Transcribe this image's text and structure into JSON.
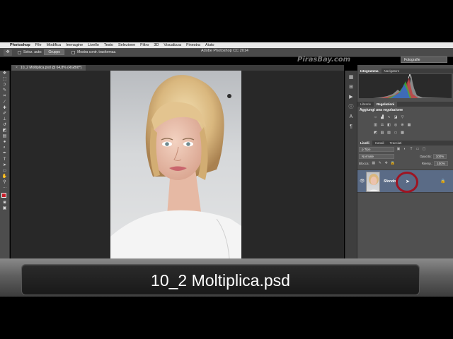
{
  "menubar": {
    "app": "Photoshop",
    "items": [
      "File",
      "Modifica",
      "Immagine",
      "Livello",
      "Testo",
      "Selezione",
      "Filtro",
      "3D",
      "Visualizza",
      "Finestra",
      "Aiuto"
    ]
  },
  "titlebar": {
    "window_title": "Adobe Photoshop CC 2014",
    "watermark": "PirasBay.com",
    "workspace": "Fotografie"
  },
  "optionsbar": {
    "autoselect_label": "Selez. auto:",
    "autoselect_value": "Gruppo",
    "transform_label": "Mostra contr. trasformaz."
  },
  "document": {
    "tab_label": "10_2 Moltiplica.psd @ 64,8% (RGB/8*)",
    "close_glyph": "×"
  },
  "panels": {
    "top_tabs": [
      "Istogramma",
      "Navigatore"
    ],
    "mid_tabs": [
      "Librerie",
      "Regolazioni"
    ],
    "adjust_title": "Aggiungi una regolazione",
    "layers_tabs": [
      "Livelli",
      "Canali",
      "Tracciati"
    ],
    "filter_kind": "ρ Tipo",
    "blend_mode": "Normale",
    "opacity_label": "Opacità:",
    "opacity_value": "100%",
    "lock_label": "Blocca:",
    "fill_label": "Riemp.:",
    "fill_value": "100%",
    "layer_name": "Sfondo"
  },
  "icons": {
    "eye": "visibility-eye-icon",
    "lock": "lock-icon",
    "cursor": "mouse-pointer-icon"
  },
  "colors": {
    "foreground": "#c81e2a",
    "highlight_circle": "#9e1422",
    "selected_layer": "#5a6b86"
  },
  "caption": {
    "text": "10_2 Moltiplica.psd"
  }
}
